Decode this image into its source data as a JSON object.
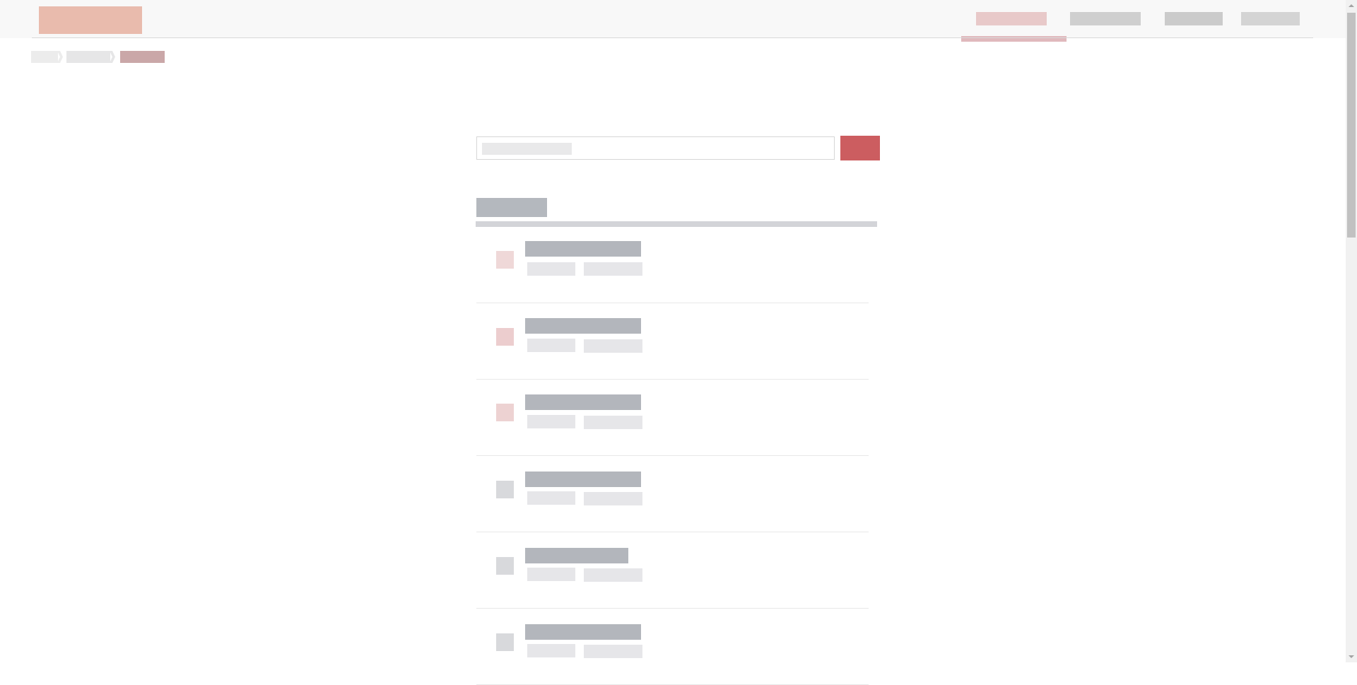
{
  "header": {
    "logo": {
      "label": "",
      "color": "#e9bbad"
    },
    "nav": [
      {
        "label": "",
        "active": true,
        "color": "#e8c9c9"
      },
      {
        "label": "",
        "active": false,
        "color": "#cfcfcf"
      },
      {
        "label": "",
        "active": false,
        "color": "#cbcbcb"
      },
      {
        "label": "",
        "active": false,
        "color": "#d4d4d4"
      }
    ],
    "active_underline_color": "#e0b9bd"
  },
  "breadcrumb": {
    "items": [
      {
        "label": "",
        "color": "#ececec"
      },
      {
        "label": "",
        "color": "#e6e6e7"
      },
      {
        "label": "",
        "color": "#caa7a8"
      }
    ]
  },
  "search": {
    "placeholder": "",
    "placeholder_color": "#e9e9ea",
    "button_label": "",
    "button_color": "#cc5d60",
    "button_icon": "search-icon"
  },
  "section": {
    "title": "",
    "title_color": "#b4b8be",
    "rule_color": "#d3d4d8"
  },
  "list": {
    "items": [
      {
        "title": "",
        "meta_1": "",
        "meta_2": "",
        "icon_color": "#efd8d8"
      },
      {
        "title": "",
        "meta_1": "",
        "meta_2": "",
        "icon_color": "#eccdce"
      },
      {
        "title": "",
        "meta_1": "",
        "meta_2": "",
        "icon_color": "#edd2d2"
      },
      {
        "title": "",
        "meta_1": "",
        "meta_2": "",
        "icon_color": "#d8d9dc"
      },
      {
        "title": "",
        "meta_1": "",
        "meta_2": "",
        "icon_color": "#d8d9dc"
      },
      {
        "title": "",
        "meta_1": "",
        "meta_2": "",
        "icon_color": "#d8d9dc"
      }
    ],
    "title_color": "#b3b6bc",
    "meta_color": "#e6e6e9"
  },
  "scrollbar": {
    "up_icon": "chevron-up-icon",
    "down_icon": "chevron-down-icon"
  }
}
